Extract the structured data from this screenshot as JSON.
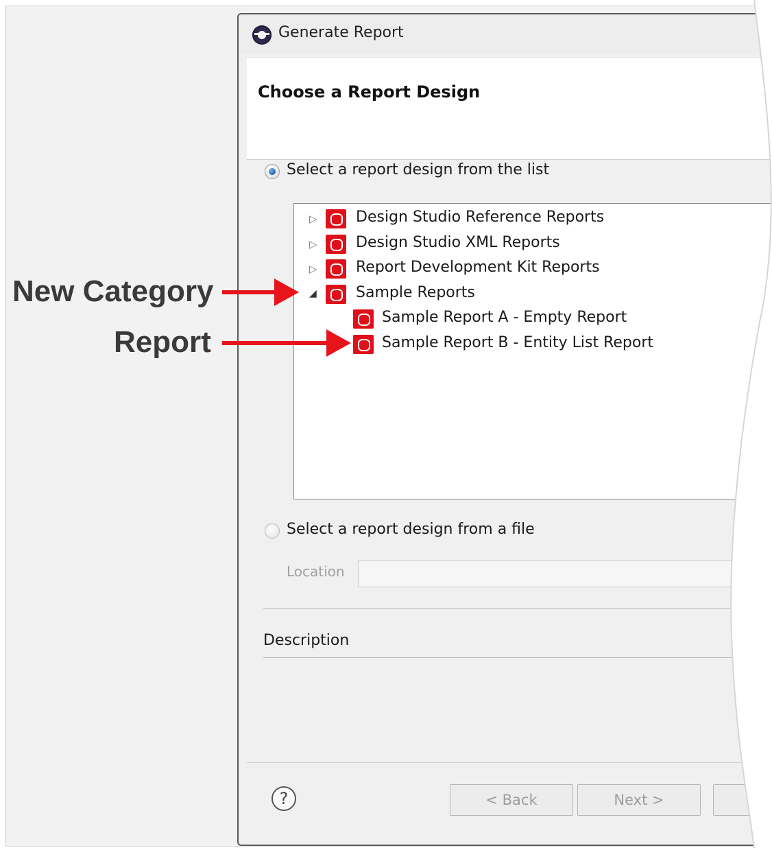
{
  "window": {
    "title": "Generate Report",
    "icon": "eclipse-icon"
  },
  "header": {
    "title": "Choose a Report Design"
  },
  "options": {
    "from_list_label": "Select a report design from the list",
    "from_list_selected": true,
    "from_file_label": "Select a report design from a file",
    "from_file_selected": false
  },
  "tree": {
    "items": [
      {
        "label": "Design Studio Reference Reports",
        "expanded": false,
        "level": 0
      },
      {
        "label": "Design Studio XML Reports",
        "expanded": false,
        "level": 0
      },
      {
        "label": "Report Development Kit Reports",
        "expanded": false,
        "level": 0
      },
      {
        "label": "Sample Reports",
        "expanded": true,
        "level": 0
      },
      {
        "label": "Sample Report A - Empty Report",
        "level": 1
      },
      {
        "label": "Sample Report B - Entity List Report",
        "level": 1
      }
    ]
  },
  "location": {
    "label": "Location",
    "value": ""
  },
  "description": {
    "label": "Description"
  },
  "footer": {
    "back_label": "< Back",
    "next_label": "Next >"
  },
  "annotations": {
    "category_label": "New Category",
    "report_label": "Report",
    "arrow_color": "#e8141b"
  },
  "colors": {
    "brand_icon": "#e0101a",
    "radio_selected": "#1f5fa8"
  }
}
